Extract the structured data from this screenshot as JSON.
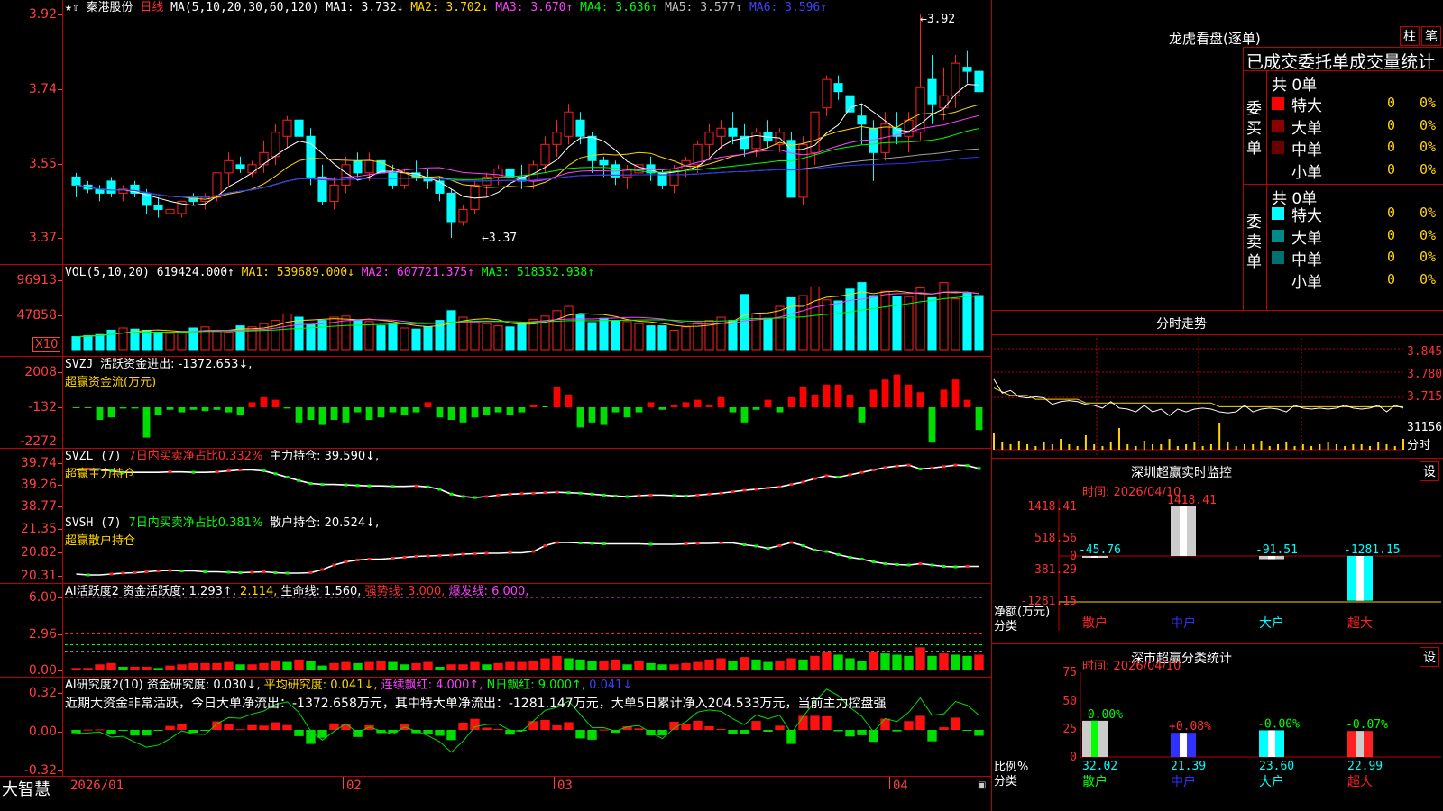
{
  "colors": {
    "up": "#ff2020",
    "down": "#00ffff",
    "ma1": "#ffffff",
    "ma2": "#ffd400",
    "ma3": "#ff40ff",
    "ma4": "#00ff00",
    "ma5": "#a0a0a0",
    "ma6": "#3030ff",
    "grid": "#b00000"
  },
  "kline": {
    "stock": "秦港股份",
    "period": "日线",
    "ma_label": "MA(5,10,20,30,60,120)",
    "ma1": "MA1: 3.732↓",
    "ma2": "MA2: 3.702↓",
    "ma3": "MA3: 3.670↑",
    "ma4": "MA4: 3.636↑",
    "ma5": "MA5: 3.577↑",
    "ma6": "MA6: 3.596↑",
    "ticks": [
      "3.92",
      "3.74",
      "3.55",
      "3.37"
    ],
    "high_mark": "3.92",
    "low_mark": "3.37",
    "candles": [
      [
        3.52,
        3.53,
        3.47,
        3.5
      ],
      [
        3.5,
        3.51,
        3.48,
        3.49
      ],
      [
        3.49,
        3.5,
        3.46,
        3.48
      ],
      [
        3.51,
        3.52,
        3.47,
        3.48
      ],
      [
        3.48,
        3.5,
        3.46,
        3.49
      ],
      [
        3.5,
        3.51,
        3.47,
        3.48
      ],
      [
        3.48,
        3.49,
        3.43,
        3.45
      ],
      [
        3.45,
        3.47,
        3.42,
        3.44
      ],
      [
        3.43,
        3.45,
        3.42,
        3.44
      ],
      [
        3.43,
        3.46,
        3.42,
        3.46
      ],
      [
        3.47,
        3.48,
        3.45,
        3.46
      ],
      [
        3.46,
        3.48,
        3.44,
        3.47
      ],
      [
        3.47,
        3.53,
        3.46,
        3.53
      ],
      [
        3.53,
        3.58,
        3.5,
        3.56
      ],
      [
        3.55,
        3.57,
        3.53,
        3.54
      ],
      [
        3.53,
        3.56,
        3.52,
        3.55
      ],
      [
        3.55,
        3.61,
        3.53,
        3.58
      ],
      [
        3.57,
        3.65,
        3.55,
        3.63
      ],
      [
        3.62,
        3.67,
        3.59,
        3.66
      ],
      [
        3.66,
        3.7,
        3.6,
        3.62
      ],
      [
        3.62,
        3.64,
        3.5,
        3.52
      ],
      [
        3.52,
        3.55,
        3.45,
        3.46
      ],
      [
        3.46,
        3.52,
        3.44,
        3.5
      ],
      [
        3.5,
        3.57,
        3.48,
        3.55
      ],
      [
        3.56,
        3.58,
        3.52,
        3.53
      ],
      [
        3.53,
        3.58,
        3.51,
        3.56
      ],
      [
        3.56,
        3.57,
        3.52,
        3.53
      ],
      [
        3.53,
        3.55,
        3.49,
        3.5
      ],
      [
        3.5,
        3.54,
        3.49,
        3.53
      ],
      [
        3.53,
        3.56,
        3.51,
        3.52
      ],
      [
        3.52,
        3.54,
        3.49,
        3.51
      ],
      [
        3.51,
        3.52,
        3.46,
        3.48
      ],
      [
        3.48,
        3.49,
        3.37,
        3.41
      ],
      [
        3.41,
        3.45,
        3.4,
        3.44
      ],
      [
        3.44,
        3.51,
        3.43,
        3.5
      ],
      [
        3.5,
        3.53,
        3.47,
        3.52
      ],
      [
        3.52,
        3.55,
        3.5,
        3.54
      ],
      [
        3.54,
        3.55,
        3.5,
        3.52
      ],
      [
        3.52,
        3.55,
        3.49,
        3.51
      ],
      [
        3.51,
        3.56,
        3.49,
        3.55
      ],
      [
        3.55,
        3.62,
        3.53,
        3.6
      ],
      [
        3.6,
        3.66,
        3.57,
        3.63
      ],
      [
        3.62,
        3.7,
        3.6,
        3.68
      ],
      [
        3.66,
        3.68,
        3.6,
        3.62
      ],
      [
        3.62,
        3.63,
        3.53,
        3.56
      ],
      [
        3.56,
        3.57,
        3.52,
        3.55
      ],
      [
        3.55,
        3.56,
        3.5,
        3.52
      ],
      [
        3.52,
        3.55,
        3.49,
        3.54
      ],
      [
        3.53,
        3.56,
        3.51,
        3.55
      ],
      [
        3.55,
        3.57,
        3.51,
        3.53
      ],
      [
        3.53,
        3.54,
        3.49,
        3.5
      ],
      [
        3.5,
        3.55,
        3.48,
        3.54
      ],
      [
        3.54,
        3.57,
        3.52,
        3.56
      ],
      [
        3.55,
        3.61,
        3.53,
        3.6
      ],
      [
        3.6,
        3.65,
        3.57,
        3.63
      ],
      [
        3.62,
        3.66,
        3.59,
        3.64
      ],
      [
        3.64,
        3.68,
        3.6,
        3.62
      ],
      [
        3.62,
        3.65,
        3.57,
        3.59
      ],
      [
        3.59,
        3.64,
        3.57,
        3.63
      ],
      [
        3.63,
        3.66,
        3.59,
        3.61
      ],
      [
        3.6,
        3.64,
        3.58,
        3.63
      ],
      [
        3.61,
        3.63,
        3.47,
        3.47
      ],
      [
        3.47,
        3.62,
        3.45,
        3.6
      ],
      [
        3.58,
        3.68,
        3.55,
        3.68
      ],
      [
        3.69,
        3.77,
        3.67,
        3.76
      ],
      [
        3.75,
        3.77,
        3.71,
        3.73
      ],
      [
        3.72,
        3.74,
        3.66,
        3.68
      ],
      [
        3.67,
        3.7,
        3.6,
        3.65
      ],
      [
        3.64,
        3.66,
        3.51,
        3.58
      ],
      [
        3.58,
        3.68,
        3.56,
        3.65
      ],
      [
        3.64,
        3.68,
        3.6,
        3.62
      ],
      [
        3.62,
        3.68,
        3.58,
        3.66
      ],
      [
        3.63,
        3.92,
        3.61,
        3.74
      ],
      [
        3.76,
        3.82,
        3.65,
        3.7
      ],
      [
        3.69,
        3.79,
        3.66,
        3.72
      ],
      [
        3.72,
        3.82,
        3.69,
        3.8
      ],
      [
        3.79,
        3.83,
        3.75,
        3.78
      ],
      [
        3.78,
        3.82,
        3.69,
        3.73
      ]
    ],
    "date_labels": [
      "2026/01",
      "02",
      "03",
      "04"
    ]
  },
  "vol": {
    "label": "VOL(5,10,20)",
    "value": "619424.000↑",
    "ma1": "MA1: 539689.000↓",
    "ma2": "MA2: 607721.375↑",
    "ma3": "MA3: 518352.938↑",
    "ticks": [
      "96913",
      "47858"
    ],
    "unit": "X10",
    "bars": [
      12,
      13,
      14,
      18,
      20,
      19,
      18,
      16,
      15,
      16,
      20,
      21,
      17,
      16,
      22,
      21,
      24,
      27,
      33,
      30,
      23,
      27,
      30,
      31,
      27,
      26,
      22,
      24,
      20,
      19,
      21,
      27,
      36,
      30,
      26,
      24,
      22,
      21,
      24,
      28,
      31,
      36,
      40,
      32,
      25,
      29,
      27,
      26,
      24,
      22,
      22,
      18,
      21,
      25,
      27,
      30,
      27,
      51,
      33,
      29,
      40,
      48,
      50,
      58,
      46,
      45,
      56,
      62,
      50,
      54,
      49,
      49,
      57,
      48,
      62,
      47,
      52,
      50
    ]
  },
  "svzj": {
    "label": "SVZJ",
    "title": "活跃资金进出: -1372.653↓,",
    "subtitle": "超赢资金流(万元)",
    "ticks": [
      "2008",
      "-132",
      "-2272"
    ],
    "bars": [
      -20,
      -20,
      -500,
      -400,
      -50,
      -50,
      -1200,
      -300,
      -100,
      -200,
      -100,
      -150,
      -100,
      -200,
      -300,
      200,
      400,
      300,
      -50,
      -600,
      -500,
      -700,
      -500,
      -600,
      -200,
      -500,
      -400,
      -200,
      -300,
      -200,
      200,
      -400,
      -500,
      -600,
      -400,
      -300,
      -200,
      -300,
      -200,
      100,
      0,
      800,
      500,
      -800,
      -600,
      -700,
      -200,
      -400,
      -200,
      200,
      -100,
      100,
      200,
      300,
      100,
      400,
      -200,
      -600,
      -100,
      300,
      -200,
      400,
      800,
      500,
      900,
      900,
      500,
      -600,
      700,
      1100,
      1300,
      900,
      600,
      -1400,
      700,
      1100,
      300,
      -900
    ]
  },
  "svzl": {
    "label": "SVZL (7)",
    "ratio": "7日内买卖净占比0.332%",
    "title": "主力持仓: 39.590↓,",
    "subtitle": "超赢主力持仓",
    "ticks": [
      "39.74",
      "39.26",
      "38.77"
    ],
    "line": [
      39.6,
      39.62,
      39.62,
      39.58,
      39.55,
      39.55,
      39.55,
      39.55,
      39.56,
      39.56,
      39.55,
      39.55,
      39.56,
      39.58,
      39.6,
      39.6,
      39.58,
      39.52,
      39.45,
      39.38,
      39.32,
      39.3,
      39.3,
      39.29,
      39.28,
      39.27,
      39.27,
      39.26,
      39.26,
      39.27,
      39.25,
      39.2,
      39.1,
      39.05,
      39.03,
      39.05,
      39.08,
      39.1,
      39.11,
      39.12,
      39.13,
      39.14,
      39.13,
      39.12,
      39.1,
      39.08,
      39.06,
      39.05,
      39.07,
      39.08,
      39.08,
      39.07,
      39.06,
      39.08,
      39.1,
      39.12,
      39.15,
      39.18,
      39.2,
      39.23,
      39.25,
      39.3,
      39.35,
      39.42,
      39.48,
      39.45,
      39.5,
      39.55,
      39.6,
      39.65,
      39.68,
      39.7,
      39.62,
      39.64,
      39.67,
      39.7,
      39.69,
      39.63
    ]
  },
  "svsh": {
    "label": "SVSH (7)",
    "ratio": "7日内买卖净占比0.381%",
    "title": "散户持仓: 20.524↓,",
    "subtitle": "超赢散户持仓",
    "ticks": [
      "21.35",
      "20.82",
      "20.31"
    ],
    "line": [
      20.35,
      20.33,
      20.33,
      20.35,
      20.37,
      20.38,
      20.4,
      20.42,
      20.43,
      20.42,
      20.42,
      20.4,
      20.4,
      20.39,
      20.38,
      20.39,
      20.4,
      20.38,
      20.37,
      20.37,
      20.38,
      20.45,
      20.55,
      20.62,
      20.66,
      20.68,
      20.68,
      20.7,
      20.72,
      20.74,
      20.75,
      20.76,
      20.77,
      20.79,
      20.8,
      20.81,
      20.81,
      20.82,
      20.82,
      20.85,
      20.98,
      21.05,
      21.05,
      21.04,
      21.03,
      21.02,
      21.02,
      21.02,
      21.02,
      21.01,
      21.01,
      21.01,
      21.02,
      21.03,
      21.03,
      21.04,
      21.04,
      21.0,
      20.97,
      20.92,
      20.98,
      21.05,
      20.98,
      20.88,
      20.85,
      20.78,
      20.72,
      20.68,
      20.62,
      20.58,
      20.56,
      20.55,
      20.58,
      20.55,
      20.52,
      20.51,
      20.52,
      20.52
    ]
  },
  "ai1": {
    "label": "AI活跃度2",
    "title": "资金活跃度: 1.293↑,",
    "v2": "2.114,",
    "life": "生命线: 1.560,",
    "strong": "强势线: 3.000,",
    "burst": "爆发线: 6.000,",
    "ticks": [
      "6.00",
      "2.96",
      "0.00"
    ],
    "bars": [
      0.2,
      0.2,
      0.5,
      0.6,
      0.3,
      0.3,
      0.3,
      0.2,
      0.4,
      0.5,
      0.6,
      0.6,
      0.6,
      0.7,
      0.5,
      0.5,
      0.6,
      0.8,
      0.7,
      0.9,
      0.8,
      0.4,
      0.6,
      0.7,
      0.6,
      0.7,
      0.8,
      0.7,
      0.5,
      0.6,
      0.7,
      0.3,
      0.5,
      0.5,
      0.7,
      0.5,
      0.6,
      0.7,
      0.7,
      0.8,
      1.0,
      1.2,
      1.0,
      0.9,
      0.8,
      0.8,
      0.9,
      0.5,
      0.8,
      0.6,
      0.5,
      0.5,
      0.6,
      0.7,
      0.9,
      1.0,
      0.8,
      1.1,
      0.9,
      0.7,
      0.8,
      1.0,
      0.9,
      1.2,
      1.5,
      1.3,
      1.0,
      0.8,
      1.5,
      1.4,
      1.3,
      1.2,
      1.9,
      1.2,
      1.4,
      1.3,
      1.2,
      1.3
    ]
  },
  "ai2": {
    "label": "AI研究度2(10)",
    "title": "资金研究度: 0.030↓,",
    "avg": "平均研究度: 0.041↓,",
    "red": "连续飘红: 4.000↑,",
    "nred": "N日飘红: 9.000↑,",
    "last": "0.041↓",
    "summary": "近期大资金非常活跃，今日大单净流出：-1372.658万元，其中特大单净流出：-1281.147万元，大单5日累计净入204.533万元，当前主力控盘强",
    "ticks": [
      "0.32",
      "0.00",
      "-0.32"
    ]
  },
  "bottom": {
    "brand": "大智慧"
  },
  "lhb": {
    "title": "龙虎看盘(逐单)",
    "btn1": "柱",
    "btn2": "笔",
    "header": "已成交委托单成交量统计",
    "buy": {
      "label": "委买单",
      "total": "共 0单",
      "rows": [
        [
          "特大",
          "0",
          "0%"
        ],
        [
          "大单",
          "0",
          "0%"
        ],
        [
          "中单",
          "0",
          "0%"
        ],
        [
          "小单",
          "0",
          "0%"
        ]
      ],
      "colors": [
        "#ff0000",
        "#8b0000",
        "#6b0000",
        "#000000"
      ]
    },
    "sell": {
      "label": "委卖单",
      "total": "共 0单",
      "rows": [
        [
          "特大",
          "0",
          "0%"
        ],
        [
          "大单",
          "0",
          "0%"
        ],
        [
          "中单",
          "0",
          "0%"
        ],
        [
          "小单",
          "0",
          "0%"
        ]
      ],
      "colors": [
        "#00ffff",
        "#008b8b",
        "#007070",
        "#000000"
      ]
    }
  },
  "intraday": {
    "title": "分时走势",
    "ticks": [
      "3.845",
      "3.780",
      "3.715",
      "31156"
    ],
    "unit": "分时",
    "price": [
      3.76,
      3.73,
      3.73,
      3.72,
      3.71,
      3.72,
      3.71,
      3.7,
      3.7,
      3.71,
      3.7,
      3.7,
      3.69,
      3.69,
      3.7,
      3.69,
      3.68,
      3.68,
      3.69,
      3.68,
      3.68,
      3.67,
      3.68,
      3.68,
      3.68,
      3.69,
      3.68,
      3.68,
      3.67,
      3.68,
      3.69,
      3.68,
      3.68,
      3.69,
      3.68,
      3.68,
      3.69,
      3.69,
      3.68,
      3.69,
      3.68,
      3.69,
      3.69,
      3.69,
      3.68,
      3.69,
      3.69,
      3.68,
      3.69,
      3.69
    ],
    "avg": [
      3.74,
      3.73,
      3.72,
      3.72,
      3.72,
      3.71,
      3.71,
      3.71,
      3.71,
      3.71,
      3.71,
      3.7,
      3.7,
      3.7,
      3.7,
      3.7,
      3.7,
      3.7,
      3.7,
      3.7,
      3.7,
      3.7,
      3.7,
      3.7,
      3.7,
      3.7,
      3.7,
      3.69,
      3.69,
      3.69,
      3.69,
      3.69,
      3.69,
      3.69,
      3.69,
      3.69,
      3.69,
      3.69,
      3.69,
      3.69,
      3.69,
      3.69,
      3.69,
      3.69,
      3.69,
      3.69,
      3.69,
      3.69,
      3.69,
      3.69
    ],
    "vol": [
      9,
      4,
      3,
      5,
      3,
      2,
      4,
      3,
      6,
      3,
      2,
      8,
      3,
      2,
      4,
      12,
      3,
      2,
      5,
      3,
      3,
      6,
      2,
      3,
      4,
      2,
      3,
      15,
      4,
      2,
      3,
      3,
      5,
      2,
      3,
      4,
      2,
      3,
      2,
      3,
      4,
      3,
      2,
      3,
      3,
      2,
      4,
      3,
      2,
      6
    ]
  },
  "monitor": {
    "title": "深圳超赢实时监控",
    "btn": "设",
    "time": "时间: 2026/04/10",
    "ticks": [
      "1418.41",
      "518.56",
      "0",
      "-381.29",
      "-1281.15"
    ],
    "ylabel": "净额(万元)",
    "xlabel": "分类",
    "cats": [
      "散户",
      "中户",
      "大户",
      "超大"
    ],
    "values": [
      -45.76,
      1418.41,
      -91.51,
      -1281.15
    ],
    "labels": [
      "-45.76",
      "1418.41",
      "-91.51",
      "-1281.15"
    ]
  },
  "classify": {
    "title": "深市超赢分类统计",
    "btn": "设",
    "time": "时间: 2026/04/10",
    "ticks": [
      "75",
      "50",
      "25",
      "0"
    ],
    "ylabel": "比例%",
    "xlabel": "分类",
    "cats": [
      "散户",
      "中户",
      "大户",
      "超大"
    ],
    "values": [
      32.02,
      21.39,
      23.6,
      22.99
    ],
    "labels": [
      "32.02",
      "21.39",
      "23.60",
      "22.99"
    ],
    "deltas": [
      "-0.00%",
      "+0.08%",
      "-0.00%",
      "-0.07%"
    ]
  }
}
